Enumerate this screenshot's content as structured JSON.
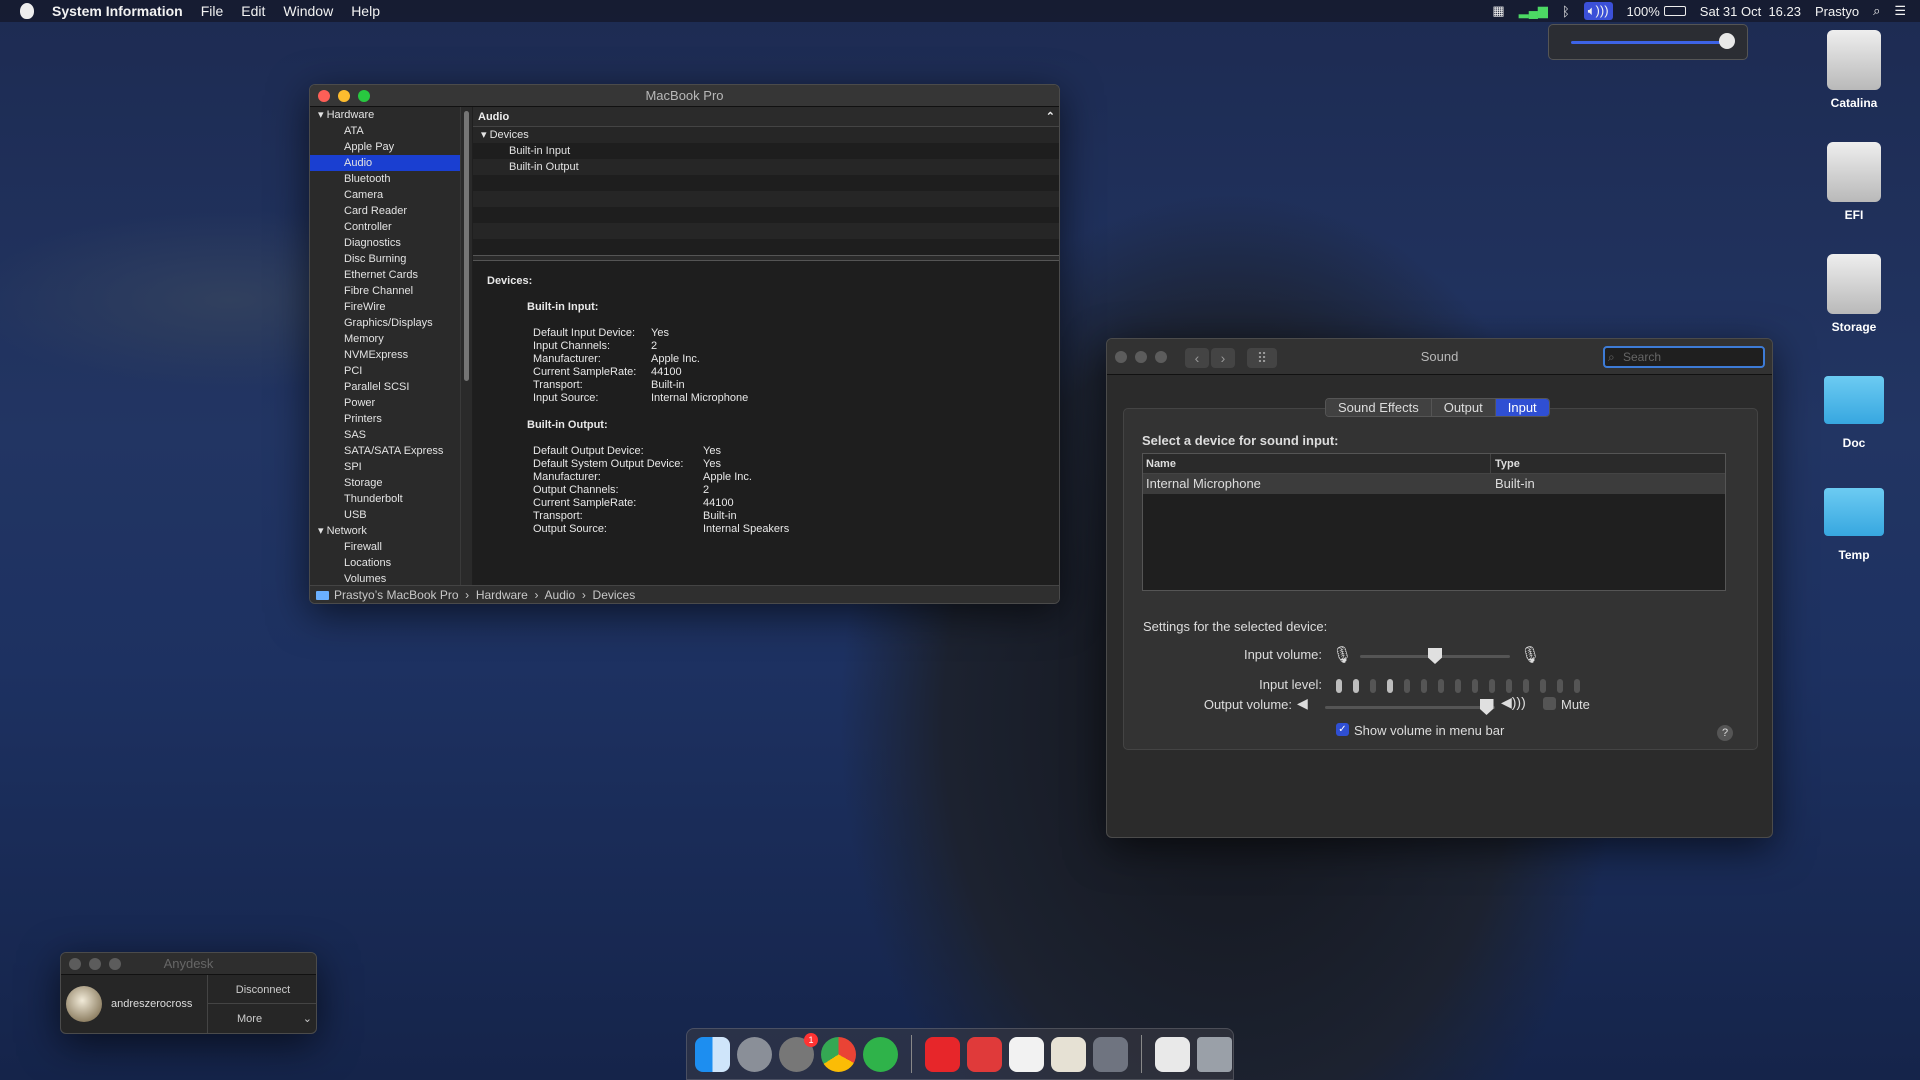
{
  "menubar": {
    "app_name": "System Information",
    "menus": [
      "File",
      "Edit",
      "Window",
      "Help"
    ],
    "battery": "100%",
    "datetime": "Sat 31 Oct  16.23",
    "user": "Prastyo",
    "icons": [
      "activity-icon",
      "wifi-signal-icon",
      "bluetooth-icon",
      "volume-icon",
      "battery-icon",
      "spotlight-icon",
      "control-center-icon"
    ]
  },
  "volume_popup": {
    "level": 1.0
  },
  "desktop": {
    "items": [
      {
        "label": "Catalina",
        "icon": "hard-drive-icon"
      },
      {
        "label": "EFI",
        "icon": "hard-drive-icon"
      },
      {
        "label": "Storage",
        "icon": "hard-drive-icon"
      },
      {
        "label": "Doc",
        "icon": "folder-icon"
      },
      {
        "label": "Temp",
        "icon": "folder-icon"
      }
    ]
  },
  "system_info": {
    "title": "MacBook Pro",
    "sidebar": {
      "hardware_label": "Hardware",
      "hardware_items": [
        "ATA",
        "Apple Pay",
        "Audio",
        "Bluetooth",
        "Camera",
        "Card Reader",
        "Controller",
        "Diagnostics",
        "Disc Burning",
        "Ethernet Cards",
        "Fibre Channel",
        "FireWire",
        "Graphics/Displays",
        "Memory",
        "NVMExpress",
        "PCI",
        "Parallel SCSI",
        "Power",
        "Printers",
        "SAS",
        "SATA/SATA Express",
        "SPI",
        "Storage",
        "Thunderbolt",
        "USB"
      ],
      "selected": "Audio",
      "network_label": "Network",
      "network_items": [
        "Firewall",
        "Locations",
        "Volumes"
      ]
    },
    "list_header": "Audio",
    "tree": {
      "group": "Devices",
      "items": [
        "Built-in Input",
        "Built-in Output"
      ]
    },
    "detail": {
      "heading": "Devices:",
      "input_heading": "Built-in Input:",
      "input_rows": [
        [
          "Default Input Device:",
          "Yes"
        ],
        [
          "Input Channels:",
          "2"
        ],
        [
          "Manufacturer:",
          "Apple Inc."
        ],
        [
          "Current SampleRate:",
          "44100"
        ],
        [
          "Transport:",
          "Built-in"
        ],
        [
          "Input Source:",
          "Internal Microphone"
        ]
      ],
      "output_heading": "Built-in Output:",
      "output_rows": [
        [
          "Default Output Device:",
          "Yes"
        ],
        [
          "Default System Output Device:",
          "Yes"
        ],
        [
          "Manufacturer:",
          "Apple Inc."
        ],
        [
          "Output Channels:",
          "2"
        ],
        [
          "Current SampleRate:",
          "44100"
        ],
        [
          "Transport:",
          "Built-in"
        ],
        [
          "Output Source:",
          "Internal Speakers"
        ]
      ]
    },
    "path": "Prastyo’s MacBook Pro  ›  Hardware  ›  Audio  ›  Devices"
  },
  "sound": {
    "title": "Sound",
    "search_placeholder": "Search",
    "tabs": [
      "Sound Effects",
      "Output",
      "Input"
    ],
    "selected_tab": "Input",
    "select_label": "Select a device for sound input:",
    "columns": [
      "Name",
      "Type"
    ],
    "devices": [
      [
        "Internal Microphone",
        "Built-in"
      ]
    ],
    "settings_label": "Settings for the selected device:",
    "input_volume_label": "Input volume:",
    "input_volume": 0.5,
    "input_level_label": "Input level:",
    "input_level_segments": 15,
    "input_level_lit": [
      0,
      1,
      3
    ],
    "output_volume_label": "Output volume:",
    "output_volume": 0.95,
    "mute_label": "Mute",
    "mute_checked": false,
    "show_volume_label": "Show volume in menu bar",
    "show_volume_checked": true,
    "help_label": "?"
  },
  "anydesk": {
    "title": "Anydesk",
    "user": "andreszerocross",
    "disconnect": "Disconnect",
    "more": "More"
  },
  "dock": {
    "apps": [
      "finder-icon",
      "launchpad-icon",
      "system-preferences-icon",
      "chrome-icon",
      "clover-icon",
      "anydesk-icon",
      "anydesk-alt-icon",
      "textedit-icon",
      "preview-icon",
      "hackintool-icon",
      "documents-icon",
      "trash-icon"
    ],
    "badge": "1"
  },
  "colors": {
    "accent": "#2f4fd3",
    "selection": "#1a3fd1",
    "close": "#fe5f57",
    "minimize": "#febc2e",
    "zoom": "#28c840"
  }
}
